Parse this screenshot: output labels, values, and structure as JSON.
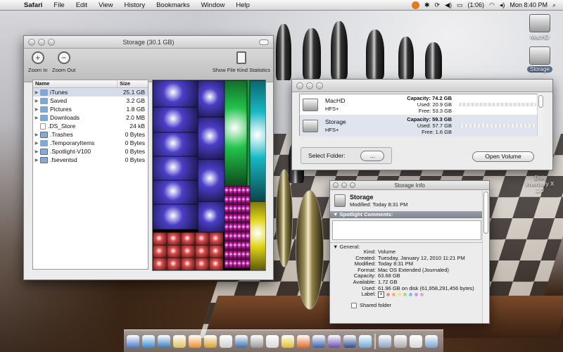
{
  "menubar": {
    "apple_glyph": "",
    "app_name": "Safari",
    "menus": [
      "File",
      "Edit",
      "View",
      "History",
      "Bookmarks",
      "Window",
      "Help"
    ],
    "battery_text": "(1:06)",
    "clock": "Mon 8:40 PM",
    "spotlight_glyph": "⌕"
  },
  "desktop": {
    "icons": [
      {
        "name": "MacHD",
        "selected": false
      },
      {
        "name": "Storage",
        "selected": true
      }
    ],
    "app_label": "Disk Inventory X 1.0"
  },
  "storage_window": {
    "title": "Storage (30.1 GB)",
    "toolbar": {
      "zoom_in": "Zoom In",
      "zoom_out": "Zoom Out",
      "show_stats": "Show File Kind Statistics"
    },
    "columns": {
      "name": "Name",
      "size": "Size"
    },
    "rows": [
      {
        "name": "iTunes",
        "size": "25.1 GB",
        "kind": "folder",
        "expandable": true,
        "selected": true
      },
      {
        "name": "Saved",
        "size": "3.2 GB",
        "kind": "folder",
        "expandable": true,
        "selected": false
      },
      {
        "name": "Pictures",
        "size": "1.8 GB",
        "kind": "folder",
        "expandable": true,
        "selected": false
      },
      {
        "name": "Downloads",
        "size": "2.0 MB",
        "kind": "folder",
        "expandable": true,
        "selected": false
      },
      {
        "name": ".DS_Store",
        "size": "24 kB",
        "kind": "file",
        "expandable": false,
        "selected": false
      },
      {
        "name": ".Trashes",
        "size": "0 Bytes",
        "kind": "trash",
        "expandable": true,
        "selected": false
      },
      {
        "name": ".TemporaryItems",
        "size": "0 Bytes",
        "kind": "folder",
        "expandable": true,
        "selected": false
      },
      {
        "name": ".Spotlight-V100",
        "size": "0 Bytes",
        "kind": "trash",
        "expandable": true,
        "selected": false
      },
      {
        "name": ".fseventsd",
        "size": "0 Bytes",
        "kind": "trash",
        "expandable": true,
        "selected": false
      }
    ]
  },
  "inventory_window": {
    "volumes": [
      {
        "name": "MacHD",
        "fs": "HFS+",
        "capacity": "Capacity: 74.2 GB",
        "used": "Used: 20.9 GB",
        "free": "Free: 53.3 GB",
        "used_fraction": 0.28,
        "selected": false
      },
      {
        "name": "Storage",
        "fs": "HFS+",
        "capacity": "Capacity: 59.3 GB",
        "used": "Used: 57.7 GB",
        "free": "Free: 1.6 GB",
        "used_fraction": 0.97,
        "selected": true
      }
    ],
    "select_folder_label": "Select Folder:",
    "select_folder_button": "...",
    "open_volume_button": "Open Volume"
  },
  "info_window": {
    "title": "Storage Info",
    "name": "Storage",
    "modified_line": "Modified: Today 8:31 PM",
    "spotlight_header": "Spotlight Comments:",
    "general_header": "General:",
    "fields": [
      {
        "k": "Kind:",
        "v": "Volume"
      },
      {
        "k": "Created:",
        "v": "Tuesday, January 12, 2010 11:21 PM"
      },
      {
        "k": "Modified:",
        "v": "Today 8:31 PM"
      },
      {
        "k": "Format:",
        "v": "Mac OS Extended (Journaled)"
      },
      {
        "k": "Capacity:",
        "v": "63.68 GB"
      },
      {
        "k": "Available:",
        "v": "1.72 GB"
      },
      {
        "k": "Used:",
        "v": "61.96 GB on disk (61,958,291,456 bytes)"
      }
    ],
    "label_key": "Label:",
    "label_none": "×",
    "label_colors": [
      "#f08a8a",
      "#f3b36a",
      "#f3e37a",
      "#a9dc84",
      "#8ab8ec",
      "#c49be0",
      "#bdbdbd"
    ],
    "shared_folder": "Shared folder"
  },
  "colors": {
    "selection": "#d5dceb",
    "treemap_itunes": "#4a3fc8",
    "treemap_red": "#d94a4a",
    "treemap_green": "#22c24a",
    "treemap_cyan": "#19b7c4",
    "treemap_yellow": "#e0d51a",
    "treemap_magenta": "#d020b0"
  },
  "dock": {
    "item_colors": [
      "#4a78c8",
      "#3a8ad0",
      "#3a78c0",
      "#e0c060",
      "#e8902a",
      "#d8a030",
      "#cfcfcf",
      "#3c6ea8",
      "#9a9a9a",
      "#d8d8d8",
      "#e0c028",
      "#e06a2a",
      "#3a60a8",
      "#6a4ab0",
      "#2a4a8a",
      "#6aa8d8",
      "#8aa0c0",
      "#aaaaaa",
      "#d8d8d8",
      "#7aa0d0"
    ]
  }
}
